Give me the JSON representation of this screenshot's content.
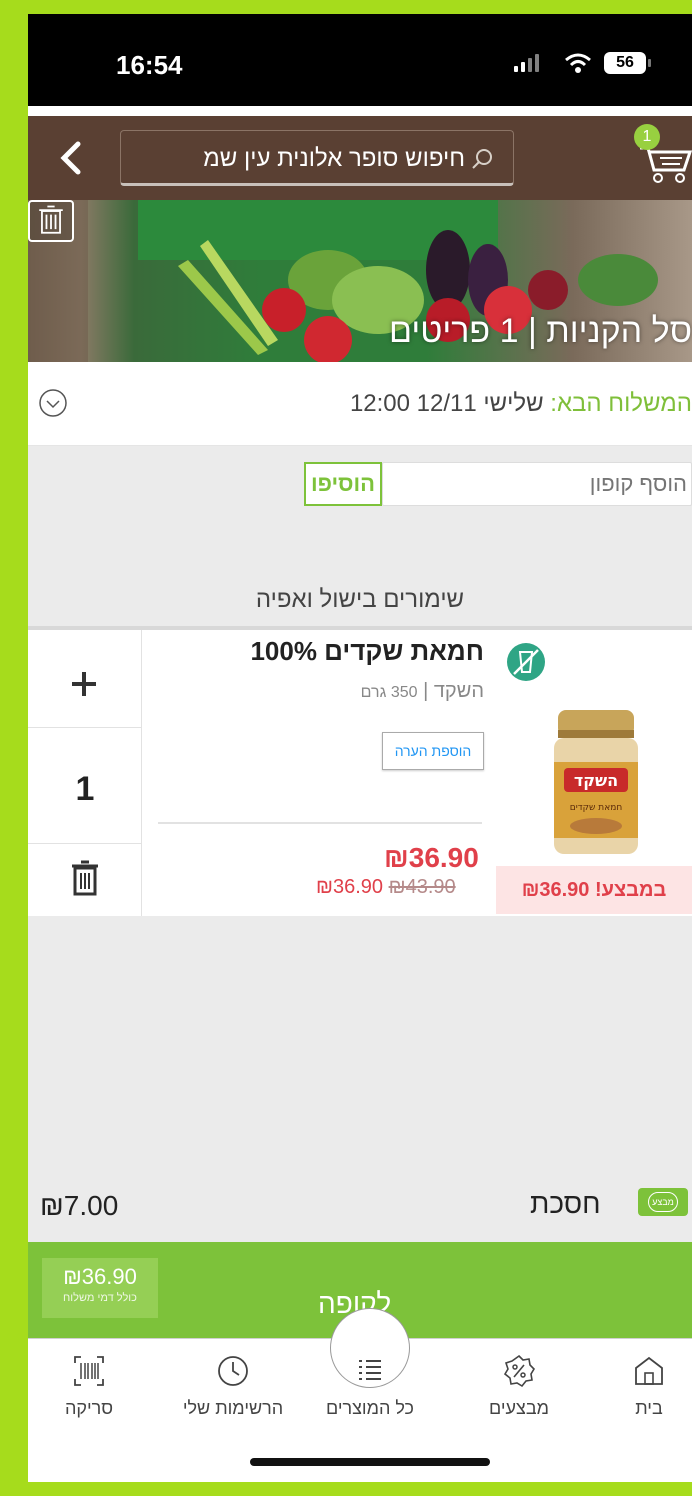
{
  "status_bar": {
    "time": "16:54",
    "battery": "56"
  },
  "header": {
    "search_placeholder": "חיפוש סופר אלונית עין שמ",
    "cart_count": "1"
  },
  "banner": {
    "title": "סל הקניות | 1 פריטים"
  },
  "delivery": {
    "label": "המשלוח הבא:",
    "value": " שלישי 12/11 12:00"
  },
  "coupon": {
    "placeholder": "הוסף קופון",
    "button": "הוסיפו"
  },
  "category": "שימורים בישול ואפיה",
  "product": {
    "name": "חמאת שקדים 100%",
    "brand": "השקד",
    "weight": "350 גרם",
    "note_button": "הוספת הערה",
    "price": "₪36.90",
    "new_price": "₪36.90",
    "old_price": "₪43.90",
    "promo": "במבצע! ₪36.90",
    "quantity": "1",
    "jar_label": "השקד",
    "jar_sublabel": "חמאת שקדים"
  },
  "savings": {
    "label": "חסכת",
    "amount": "₪7.00",
    "icon_text": "מבצע"
  },
  "checkout": {
    "label": "לקופה",
    "total": "₪36.90",
    "total_note": "כולל דמי משלוח"
  },
  "nav": {
    "scan": "סריקה",
    "my_lists": "הרשימות שלי",
    "all_products": "כל המוצרים",
    "deals": "מבצעים",
    "home": "בית"
  },
  "colors": {
    "brand_green": "#7dc23a",
    "header_brown": "#5a4033",
    "price_red": "#e0404a",
    "page_lime": "#a6dc1c"
  }
}
